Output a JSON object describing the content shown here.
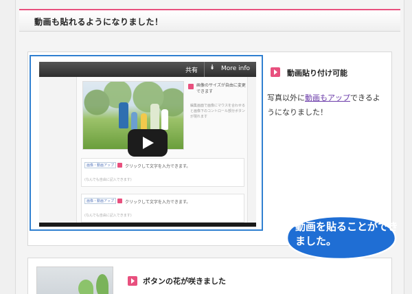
{
  "header": {
    "title": "動画も貼れるようになりました！"
  },
  "video": {
    "share_label": "共有",
    "more_info_label": "More info",
    "inner": {
      "side_heading": "画像のサイズが自由に変更できます",
      "side_text": "編集画面で画像にマウスを合わせると画像下のコントロール部分ボタンが現れます",
      "blocks": [
        {
          "tag": "画像・動画アップ",
          "text": "クリックして文字を入力できます。",
          "sub": "(なんでも自由に記入できます)"
        },
        {
          "tag": "画像・動画アップ",
          "text": "クリックして文字を入力できます。",
          "sub": "(なんでも自由に記入できます)"
        }
      ]
    }
  },
  "feature1": {
    "title": "動画貼り付け可能",
    "desc_before": "写真以外に",
    "desc_link": "動画もアップ",
    "desc_after": "できるようになりました！"
  },
  "callout": {
    "text": "動画を貼ることができました。"
  },
  "feature2": {
    "title": "ボタンの花が咲きました"
  },
  "colors": {
    "accent_pink": "#e8507e",
    "frame_blue": "#2f7fd0",
    "callout_blue": "#1f6ed4"
  }
}
